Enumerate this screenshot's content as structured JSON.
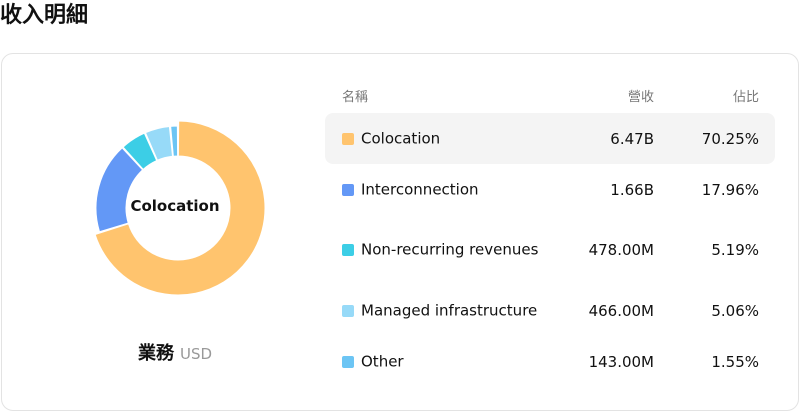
{
  "page": {
    "title": "收入明細"
  },
  "chart": {
    "center_label": "Colocation",
    "legend_title": "業務",
    "legend_unit": "USD"
  },
  "table": {
    "headers": {
      "name": "名稱",
      "revenue": "營收",
      "share": "佔比"
    }
  },
  "chart_data": {
    "type": "pie",
    "title": "",
    "categories": [
      "Colocation",
      "Interconnection",
      "Non-recurring revenues",
      "Managed infrastructure",
      "Other"
    ],
    "values": [
      6.47,
      1.66,
      0.478,
      0.466,
      0.143
    ],
    "value_labels": [
      "6.47B",
      "1.66B",
      "478.00M",
      "466.00M",
      "143.00M"
    ],
    "shares": [
      "70.25%",
      "17.96%",
      "5.19%",
      "5.06%",
      "1.55%"
    ],
    "percent_values": [
      70.25,
      17.96,
      5.19,
      5.06,
      1.55
    ],
    "colors": [
      "#FFC46E",
      "#6398F6",
      "#3CCEE6",
      "#97DAF8",
      "#6CC5F4"
    ],
    "unit": "USD",
    "donut": true,
    "highlighted": "Colocation"
  }
}
